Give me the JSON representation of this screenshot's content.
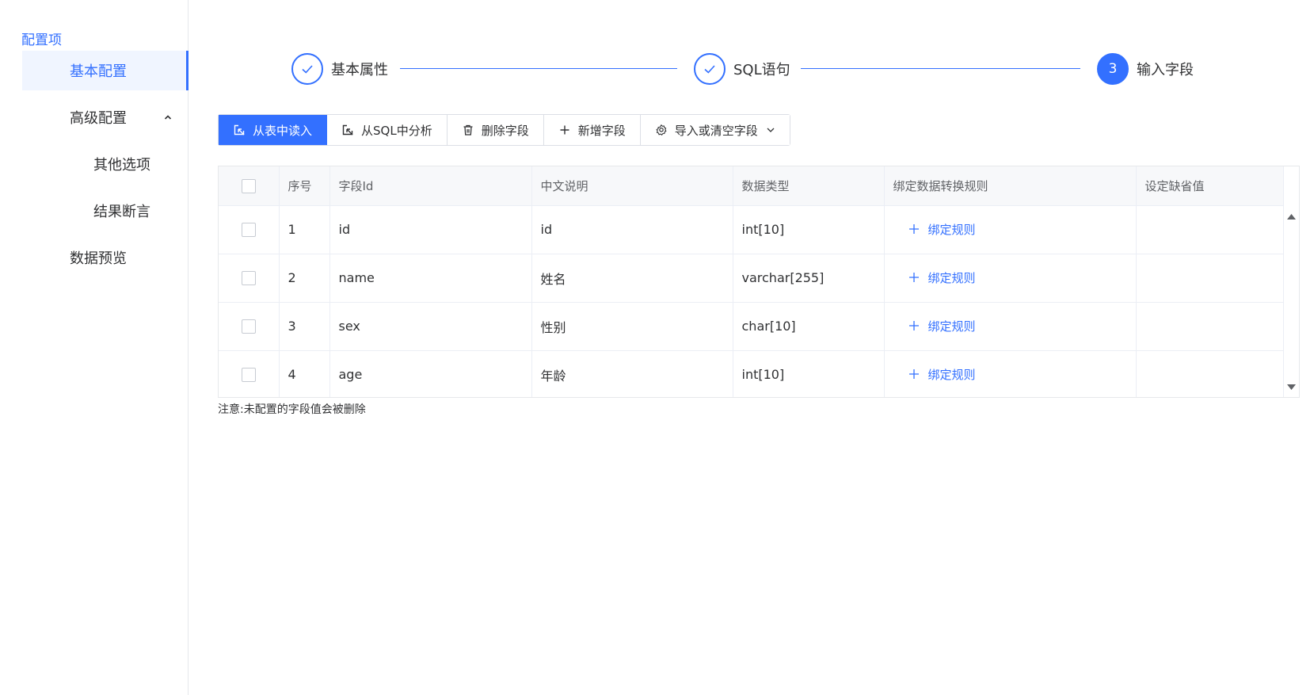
{
  "sidebar": {
    "header": "配置项",
    "items": [
      {
        "label": "基本配置"
      },
      {
        "label": "高级配置"
      },
      {
        "label": "其他选项"
      },
      {
        "label": "结果断言"
      },
      {
        "label": "数据预览"
      }
    ],
    "expand_icon": "chevron-up-icon"
  },
  "steps": [
    {
      "label": "基本属性",
      "status": "done",
      "icon": "check-icon"
    },
    {
      "label": "SQL语句",
      "status": "done",
      "icon": "check-icon"
    },
    {
      "label": "输入字段",
      "status": "current",
      "number": "3"
    }
  ],
  "toolbar": {
    "buttons": [
      {
        "label": "从表中读入",
        "icon": "import-cursor-icon"
      },
      {
        "label": "从SQL中分析",
        "icon": "import-cursor-icon"
      },
      {
        "label": "删除字段",
        "icon": "trash-icon"
      },
      {
        "label": "新增字段",
        "icon": "plus-icon"
      },
      {
        "label": "导入或清空字段",
        "icon": "gear-icon"
      }
    ]
  },
  "table": {
    "headers": [
      "序号",
      "字段Id",
      "中文说明",
      "数据类型",
      "绑定数据转换规则",
      "设定缺省值"
    ],
    "rows": [
      {
        "index": "1",
        "field_id": "id",
        "desc": "id",
        "type": "int[10]",
        "bind": "绑定规则",
        "default": ""
      },
      {
        "index": "2",
        "field_id": "name",
        "desc": "姓名",
        "type": "varchar[255]",
        "bind": "绑定规则",
        "default": ""
      },
      {
        "index": "3",
        "field_id": "sex",
        "desc": "性别",
        "type": "char[10]",
        "bind": "绑定规则",
        "default": ""
      },
      {
        "index": "4",
        "field_id": "age",
        "desc": "年龄",
        "type": "int[10]",
        "bind": "绑定规则",
        "default": ""
      }
    ]
  },
  "note": "注意:未配置的字段值会被删除",
  "colors": {
    "accent": "#3370ff",
    "header_bg": "#f7f8fa",
    "active_menu_bg": "#f0f5ff"
  }
}
